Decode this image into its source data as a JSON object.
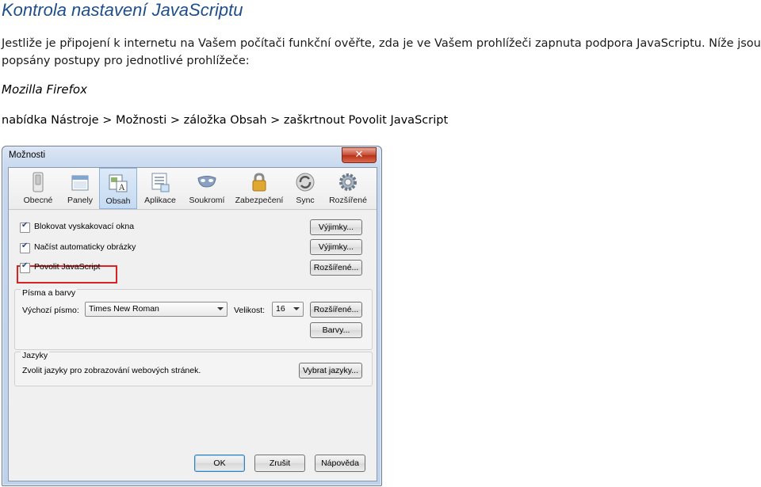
{
  "doc": {
    "title": "Kontrola nastavení JavaScriptu",
    "paragraph": "Jestliže je připojení k internetu na Vašem počítači funkční ověřte, zda je ve Vašem prohlížeči zapnuta podpora JavaScriptu. Níže jsou popsány postupy pro jednotlivé prohlížeče:",
    "browser_heading": "Mozilla Firefox",
    "path": "nabídka Nástroje > Možnosti > záložka Obsah > zaškrtnout Povolit JavaScript"
  },
  "dialog": {
    "title": "Možnosti",
    "close_label": "✕",
    "tabs": [
      {
        "label": "Obecné",
        "icon": "switch-icon"
      },
      {
        "label": "Panely",
        "icon": "tabs-icon"
      },
      {
        "label": "Obsah",
        "icon": "content-icon",
        "active": true
      },
      {
        "label": "Aplikace",
        "icon": "applications-icon"
      },
      {
        "label": "Soukromí",
        "icon": "mask-icon"
      },
      {
        "label": "Zabezpečení",
        "icon": "lock-icon"
      },
      {
        "label": "Sync",
        "icon": "sync-icon"
      },
      {
        "label": "Rozšířené",
        "icon": "gear-icon"
      }
    ],
    "content": {
      "checkboxes": [
        {
          "label": "Blokovat vyskakovací okna",
          "checked": true
        },
        {
          "label": "Načíst automaticky obrázky",
          "checked": true
        },
        {
          "label": "Povolit JavaScript",
          "checked": true
        }
      ],
      "buttons": [
        "Výjimky...",
        "Výjimky...",
        "Rozšířené..."
      ]
    },
    "fonts": {
      "title": "Písma a barvy",
      "default_font_label": "Výchozí písmo:",
      "default_font_value": "Times New Roman",
      "size_label": "Velikost:",
      "size_value": "16",
      "advanced_button": "Rozšířené...",
      "colors_button": "Barvy..."
    },
    "languages": {
      "title": "Jazyky",
      "description": "Zvolit jazyky pro zobrazování webových stránek.",
      "choose_button": "Vybrat jazyky..."
    },
    "footer": {
      "ok": "OK",
      "cancel": "Zrušit",
      "help": "Nápověda"
    }
  }
}
